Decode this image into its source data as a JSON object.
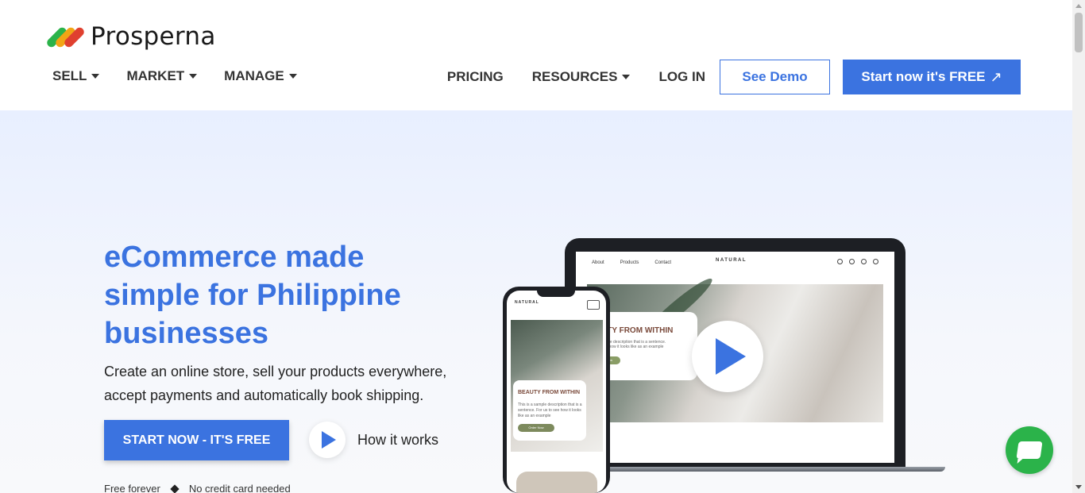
{
  "brand": {
    "name": "Prosperna",
    "logo_colors": [
      "#2bb34a",
      "#f2a515",
      "#e0402f"
    ]
  },
  "nav": {
    "left": [
      {
        "label": "SELL",
        "icon": "caret-down-icon"
      },
      {
        "label": "MARKET",
        "icon": "caret-down-icon"
      },
      {
        "label": "MANAGE",
        "icon": "caret-down-icon"
      }
    ],
    "pricing": "PRICING",
    "resources": "RESOURCES",
    "login": "LOG IN",
    "see_demo": "See Demo",
    "start_free": "Start now it's FREE",
    "start_free_icon": "arrow-up-right-icon"
  },
  "hero": {
    "title": "eCommerce made simple for Philippine businesses",
    "subtitle": "Create an online store, sell your products everywhere, accept payments and automatically book shipping.",
    "cta": "START NOW - IT'S FREE",
    "how_it_works": "How it works",
    "note_left": "Free forever",
    "note_right": "No credit card needed"
  },
  "mockup": {
    "laptop_nav": [
      "About",
      "Products",
      "Contact"
    ],
    "brand": "NATURAL",
    "laptop_card_title": "UTY FROM WITHIN",
    "laptop_card_desc": "ample description that is a sentence. see how it looks like as an example",
    "laptop_card_button": "Now",
    "phone_brand": "NATURAL",
    "phone_card_title": "BEAUTY FROM WITHIN",
    "phone_card_desc": "This is a sample description that is a sentence. For us to see how it looks like as an example",
    "phone_card_button": "Order Now"
  },
  "colors": {
    "accent": "#3b73e0",
    "hero_bg": "#e8efff",
    "chat": "#2bb34a"
  }
}
